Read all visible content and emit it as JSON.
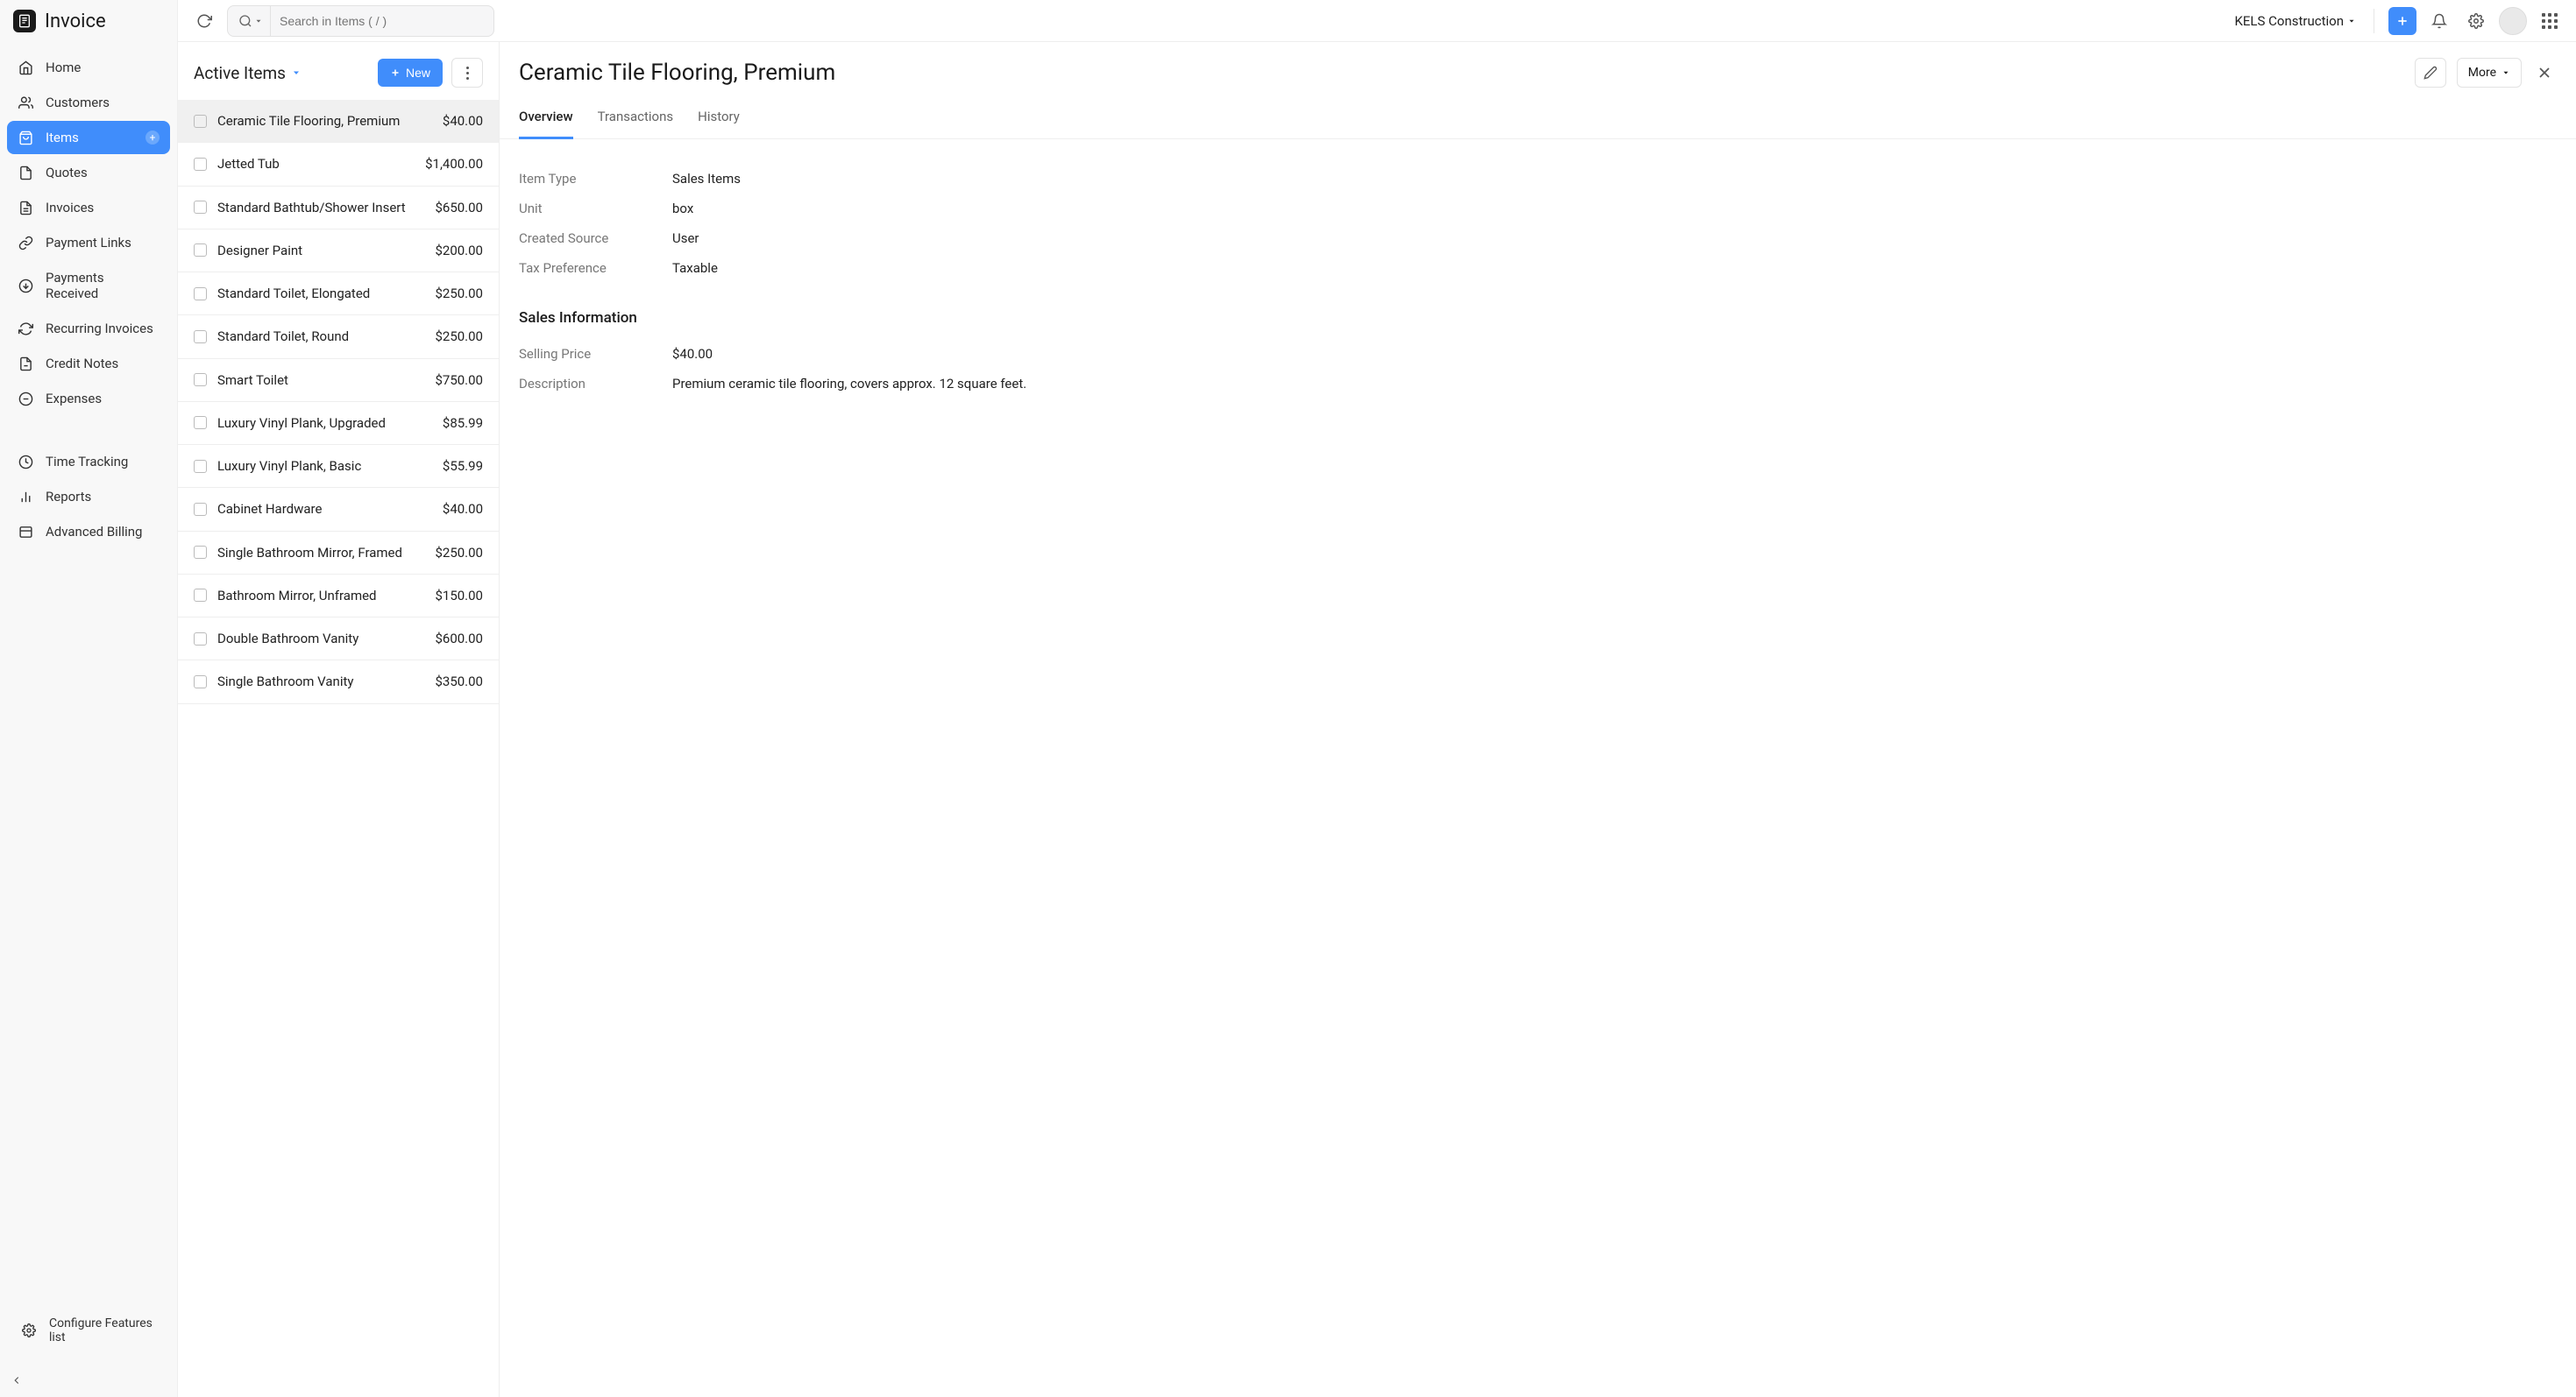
{
  "app": {
    "title": "Invoice"
  },
  "topbar": {
    "search_placeholder": "Search in Items ( / )",
    "org_name": "KELS Construction"
  },
  "sidebar": {
    "items": [
      {
        "label": "Home"
      },
      {
        "label": "Customers"
      },
      {
        "label": "Items",
        "active": true,
        "add": true
      },
      {
        "label": "Quotes"
      },
      {
        "label": "Invoices"
      },
      {
        "label": "Payment Links"
      },
      {
        "label": "Payments Received"
      },
      {
        "label": "Recurring Invoices"
      },
      {
        "label": "Credit Notes"
      },
      {
        "label": "Expenses"
      }
    ],
    "secondary": [
      {
        "label": "Time Tracking"
      },
      {
        "label": "Reports"
      },
      {
        "label": "Advanced Billing"
      }
    ],
    "footer": {
      "label": "Configure Features list"
    }
  },
  "list": {
    "title": "Active Items",
    "new_label": "New",
    "items": [
      {
        "name": "Ceramic Tile Flooring, Premium",
        "price": "$40.00",
        "selected": true
      },
      {
        "name": "Jetted Tub",
        "price": "$1,400.00"
      },
      {
        "name": "Standard Bathtub/Shower Insert",
        "price": "$650.00"
      },
      {
        "name": "Designer Paint",
        "price": "$200.00"
      },
      {
        "name": "Standard Toilet, Elongated",
        "price": "$250.00"
      },
      {
        "name": "Standard Toilet, Round",
        "price": "$250.00"
      },
      {
        "name": "Smart Toilet",
        "price": "$750.00"
      },
      {
        "name": "Luxury Vinyl Plank, Upgraded",
        "price": "$85.99"
      },
      {
        "name": "Luxury Vinyl Plank, Basic",
        "price": "$55.99"
      },
      {
        "name": "Cabinet Hardware",
        "price": "$40.00"
      },
      {
        "name": "Single Bathroom Mirror, Framed",
        "price": "$250.00"
      },
      {
        "name": "Bathroom Mirror, Unframed",
        "price": "$150.00"
      },
      {
        "name": "Double Bathroom Vanity",
        "price": "$600.00"
      },
      {
        "name": "Single Bathroom Vanity",
        "price": "$350.00"
      }
    ]
  },
  "detail": {
    "title": "Ceramic Tile Flooring, Premium",
    "more_label": "More",
    "tabs": [
      {
        "label": "Overview",
        "active": true
      },
      {
        "label": "Transactions"
      },
      {
        "label": "History"
      }
    ],
    "basic": [
      {
        "label": "Item Type",
        "value": "Sales Items"
      },
      {
        "label": "Unit",
        "value": "box"
      },
      {
        "label": "Created Source",
        "value": "User"
      },
      {
        "label": "Tax Preference",
        "value": "Taxable"
      }
    ],
    "sales_section_title": "Sales Information",
    "sales": [
      {
        "label": "Selling Price",
        "value": "$40.00"
      },
      {
        "label": "Description",
        "value": "Premium ceramic tile flooring, covers approx. 12 square feet."
      }
    ]
  }
}
